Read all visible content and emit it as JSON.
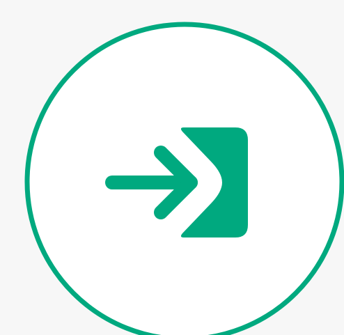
{
  "icon": {
    "name": "login-enter-icon",
    "colors": {
      "background": "#f7f7f7",
      "circle_fill": "#ffffff",
      "accent": "#00a97f"
    }
  }
}
